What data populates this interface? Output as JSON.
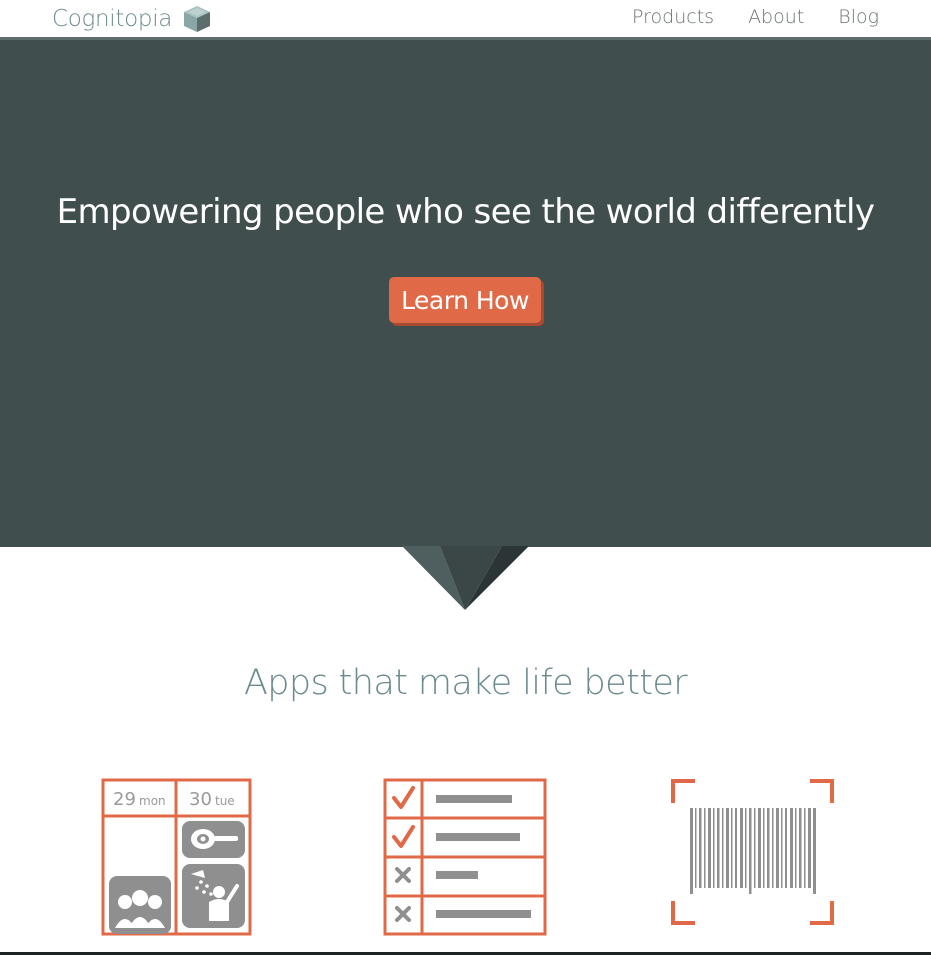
{
  "navbar": {
    "brand": "Cognitopia",
    "brand_icon": "cube-logo-icon",
    "links": [
      "Products",
      "About",
      "Blog"
    ]
  },
  "hero": {
    "title": "Empowering people who see the world differently",
    "cta_label": "Learn How",
    "background": "#414e4e",
    "accent": "#e06a47"
  },
  "apps_section": {
    "title": "Apps that make life better",
    "calendar": {
      "days": [
        {
          "num": "29",
          "name": "mon"
        },
        {
          "num": "30",
          "name": "tue"
        }
      ],
      "icon": "calendar-schedule-icon"
    },
    "checklist_icon": "checklist-icon",
    "barcode_icon": "barcode-scanner-icon"
  }
}
